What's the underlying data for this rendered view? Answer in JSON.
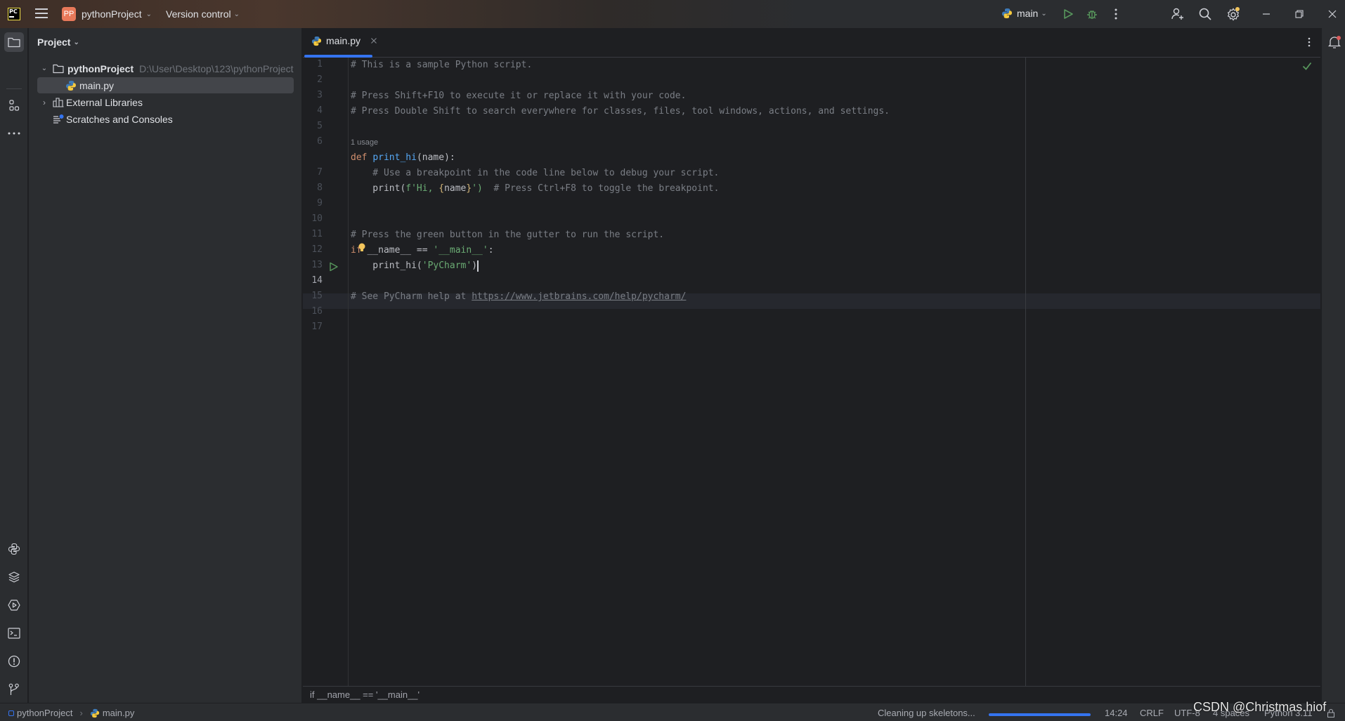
{
  "titlebar": {
    "logo_text": "PC",
    "project_badge": "PP",
    "project_name": "pythonProject",
    "version_control": "Version control",
    "run_config": "main"
  },
  "project_panel": {
    "title": "Project",
    "tree": [
      {
        "label": "pythonProject",
        "path": "D:\\User\\Desktop\\123\\pythonProject",
        "expanded": true
      },
      {
        "label": "main.py",
        "selected": true
      },
      {
        "label": "External Libraries",
        "expanded": false
      },
      {
        "label": "Scratches and Consoles"
      }
    ]
  },
  "editor": {
    "tab_label": "main.py",
    "current_line": 14,
    "usage_hint": "1 usage",
    "line_numbers": [
      "1",
      "2",
      "3",
      "4",
      "5",
      "6",
      "7",
      "8",
      "9",
      "10",
      "11",
      "12",
      "13",
      "14",
      "15",
      "16",
      "17"
    ],
    "lines": {
      "l1": "# This is a sample Python script.",
      "l3": "# Press Shift+F10 to execute it or replace it with your code.",
      "l4": "# Press Double Shift to search everywhere for classes, files, tool windows, actions, and settings.",
      "l7_kw": "def",
      "l7_fn": "print_hi",
      "l7_rest": "(name):",
      "l8": "    # Use a breakpoint in the code line below to debug your script.",
      "l9_a": "    print(",
      "l9_b": "f'Hi, ",
      "l9_c": "{",
      "l9_d": "name",
      "l9_e": "}",
      "l9_f": "')",
      "l9_g": "  # Press Ctrl+F8 to toggle the breakpoint.",
      "l12": "# Press the green button in the gutter to run the script.",
      "l13_kw": "if",
      "l13_a": " __name__ == ",
      "l13_str": "'__main__'",
      "l13_b": ":",
      "l14_a": "    print_hi(",
      "l14_str": "'PyCharm'",
      "l14_b": ")",
      "l16_a": "# See PyCharm help at ",
      "l16_url": "https://www.jetbrains.com/help/pycharm/"
    },
    "breadcrumb": "if __name__ == '__main__'"
  },
  "statusbar": {
    "project": "pythonProject",
    "file": "main.py",
    "task": "Cleaning up skeletons...",
    "task_progress": 1.0,
    "position": "14:24",
    "line_sep": "CRLF",
    "encoding": "UTF-8",
    "indent": "4 spaces",
    "interpreter": "Python 3.11"
  },
  "watermark": "CSDN @Christmas.hiof"
}
